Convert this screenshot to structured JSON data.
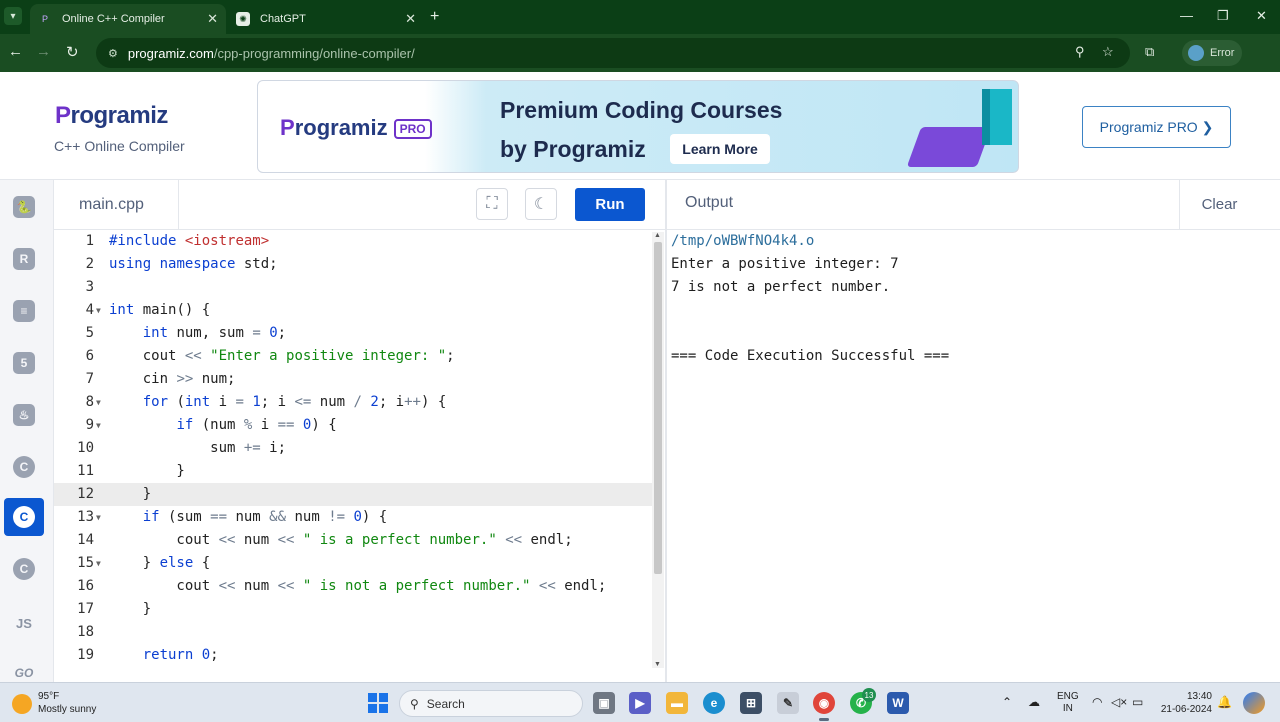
{
  "browser": {
    "tabs": [
      {
        "title": "Online C++ Compiler",
        "active": true
      },
      {
        "title": "ChatGPT",
        "active": false
      }
    ],
    "url_host": "programiz.com",
    "url_path": "/cpp-programming/online-compiler/",
    "profile_label": "Error"
  },
  "site": {
    "logo_first": "P",
    "logo_rest": "rogramiz",
    "subtitle": "C++ Online Compiler",
    "banner": {
      "logo_first": "P",
      "logo_rest": "rogramiz",
      "pro_badge": "PRO",
      "line1": "Premium Coding Courses",
      "line2": "by Programiz",
      "cta": "Learn More"
    },
    "pro_button": "Programiz PRO ❯"
  },
  "rail": {
    "items": [
      {
        "name": "python",
        "glyph": "🐍"
      },
      {
        "name": "r",
        "glyph": "R"
      },
      {
        "name": "sql",
        "glyph": "≡"
      },
      {
        "name": "html",
        "glyph": "5"
      },
      {
        "name": "java",
        "glyph": "♨"
      },
      {
        "name": "c",
        "glyph": "C"
      },
      {
        "name": "cpp",
        "glyph": "C"
      },
      {
        "name": "csharp",
        "glyph": "C"
      },
      {
        "name": "js",
        "glyph": "JS"
      },
      {
        "name": "go",
        "glyph": "GO"
      }
    ],
    "active": "cpp"
  },
  "editor": {
    "file_name": "main.cpp",
    "run_label": "Run",
    "highlighted_line": 12,
    "lines": [
      "#include <iostream>",
      "using namespace std;",
      "",
      "int main() {",
      "    int num, sum = 0;",
      "    cout << \"Enter a positive integer: \";",
      "    cin >> num;",
      "    for (int i = 1; i <= num / 2; i++) {",
      "        if (num % i == 0) {",
      "            sum += i;",
      "        }",
      "    }",
      "    if (sum == num && num != 0) {",
      "        cout << num << \" is a perfect number.\" << endl;",
      "    } else {",
      "        cout << num << \" is not a perfect number.\" << endl;",
      "    }",
      "",
      "    return 0;"
    ],
    "fold_lines": [
      4,
      8,
      9,
      13,
      15
    ]
  },
  "output": {
    "title": "Output",
    "clear_label": "Clear",
    "lines": [
      "/tmp/oWBWfNO4k4.o",
      "Enter a positive integer: 7",
      "7 is not a perfect number.",
      "",
      "",
      "=== Code Execution Successful ==="
    ]
  },
  "taskbar": {
    "weather_temp": "95°F",
    "weather_desc": "Mostly sunny",
    "search_label": "Search",
    "whatsapp_badge": "13",
    "lang_line1": "ENG",
    "lang_line2": "IN",
    "time": "13:40",
    "date": "21-06-2024"
  }
}
